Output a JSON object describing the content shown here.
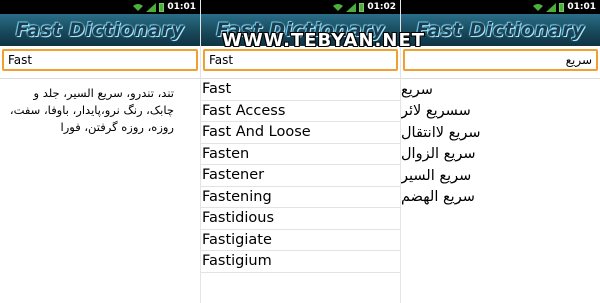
{
  "panels": [
    {
      "status": {
        "time": "01:01"
      },
      "title": "Fast Dictionary",
      "search_value": "Fast",
      "definition": "تند، تندرو، سریع السیر، جلد و چابک، رنگ نرو،پایدار، باوفا، سفت، روزه، روزه گرفتن، فورا"
    },
    {
      "status": {
        "time": "01:02"
      },
      "title": "Fast Dictionary",
      "search_value": "Fast",
      "results": [
        "Fast",
        "Fast Access",
        "Fast And Loose",
        "Fasten",
        "Fastener",
        "Fastening",
        "Fastidious",
        "Fastigiate",
        "Fastigium"
      ]
    },
    {
      "status": {
        "time": "01:01"
      },
      "title": "Fast Dictionary",
      "search_value": "سریع",
      "results": [
        "سریع",
        "سسریع لائر",
        "سریع لاانتقال",
        "سریع الزوال",
        "سریع السیر",
        "سریع الهضم"
      ]
    }
  ],
  "watermark": "WWW.TEBYAN.NET",
  "colors": {
    "accent": "#f0a033",
    "titlebar": "#174657",
    "title_glow": "#9ee3ff",
    "battery": "#4caf3c"
  }
}
